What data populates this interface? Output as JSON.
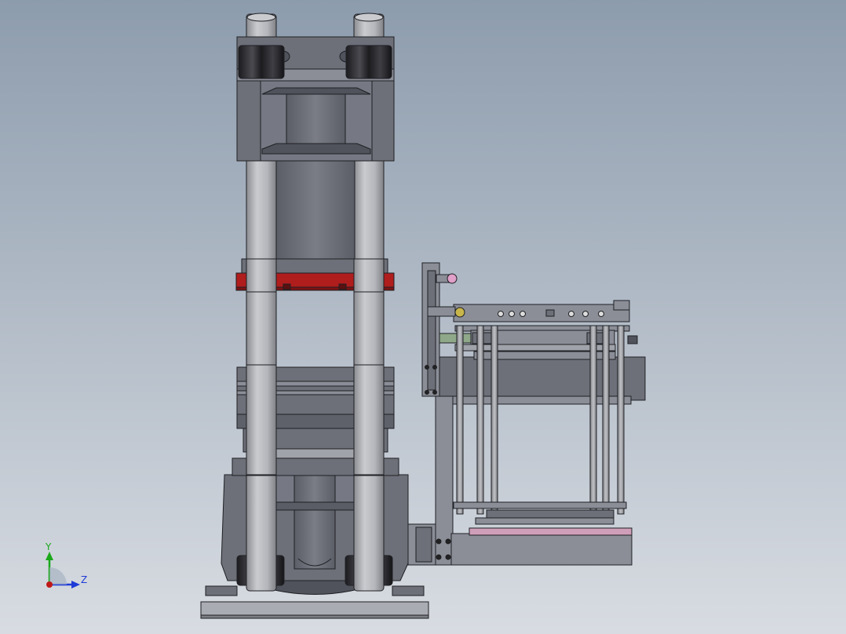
{
  "view": {
    "background_top": "#8d9cad",
    "background_bottom": "#d8dce2"
  },
  "colors": {
    "steel": "#6d7079",
    "steel_dark": "#50535b",
    "steel_light": "#8b8e97",
    "column": "#b4b6bb",
    "column_shade": "#8a8c91",
    "nut": "#2b2b2e",
    "red_platen": "#b01d1d",
    "green_part": "#8fa88a",
    "pink_plate": "#cf9fb9",
    "pink_knob": "#e0a0c8",
    "outline": "#1f2024"
  },
  "triad": {
    "y_label": "Y",
    "z_label": "Z",
    "y_color": "#1aa81a",
    "z_color": "#1e3bd6",
    "origin_color": "#c01818"
  }
}
